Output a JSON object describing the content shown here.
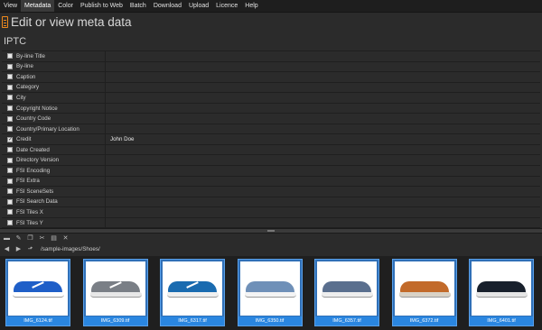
{
  "menu": [
    "View",
    "Metadata",
    "Color",
    "Publish to Web",
    "Batch",
    "Download",
    "Upload",
    "Licence",
    "Help"
  ],
  "menu_active": "Metadata",
  "page_title": "Edit or view meta data",
  "section_title": "IPTC",
  "fields": [
    {
      "label": "By-line Title",
      "checked": false,
      "value": ""
    },
    {
      "label": "By-line",
      "checked": false,
      "value": ""
    },
    {
      "label": "Caption",
      "checked": false,
      "value": ""
    },
    {
      "label": "Category",
      "checked": false,
      "value": ""
    },
    {
      "label": "City",
      "checked": false,
      "value": ""
    },
    {
      "label": "Copyright Notice",
      "checked": false,
      "value": ""
    },
    {
      "label": "Country Code",
      "checked": false,
      "value": ""
    },
    {
      "label": "Country/Primary Location",
      "checked": false,
      "value": ""
    },
    {
      "label": "Credit",
      "checked": true,
      "value": "John Doe"
    },
    {
      "label": "Date Created",
      "checked": false,
      "value": ""
    },
    {
      "label": "Directory Version",
      "checked": false,
      "value": ""
    },
    {
      "label": "FSI Encoding",
      "checked": false,
      "value": ""
    },
    {
      "label": "FSI Extra",
      "checked": false,
      "value": ""
    },
    {
      "label": "FSI SceneSets",
      "checked": false,
      "value": ""
    },
    {
      "label": "FSI Search Data",
      "checked": false,
      "value": ""
    },
    {
      "label": "FSI Tiles X",
      "checked": false,
      "value": ""
    },
    {
      "label": "FSI Tiles Y",
      "checked": false,
      "value": ""
    }
  ],
  "toolbar_icons": [
    "folder-icon",
    "edit-icon",
    "copy-icon",
    "cut-icon",
    "paste-icon",
    "close-icon"
  ],
  "path": "/sample-images/Shoes/",
  "thumbnails": [
    {
      "name": "IMG_6124.tif",
      "upper": "#1f5fc8",
      "sole": "#ffffff"
    },
    {
      "name": "IMG_6309.tif",
      "upper": "#7a7f86",
      "sole": "#e8e8e8"
    },
    {
      "name": "IMG_6317.tif",
      "upper": "#1a6bb0",
      "sole": "#f0f0f0"
    },
    {
      "name": "IMG_6350.tif",
      "upper": "#6f90b8",
      "sole": "#f4f4f4"
    },
    {
      "name": "IMG_6357.tif",
      "upper": "#5a6f8e",
      "sole": "#eeeeee"
    },
    {
      "name": "IMG_6372.tif",
      "upper": "#c26a2a",
      "sole": "#d9d2c6"
    },
    {
      "name": "IMG_6401.tif",
      "upper": "#18202c",
      "sole": "#e6e6e6"
    }
  ]
}
